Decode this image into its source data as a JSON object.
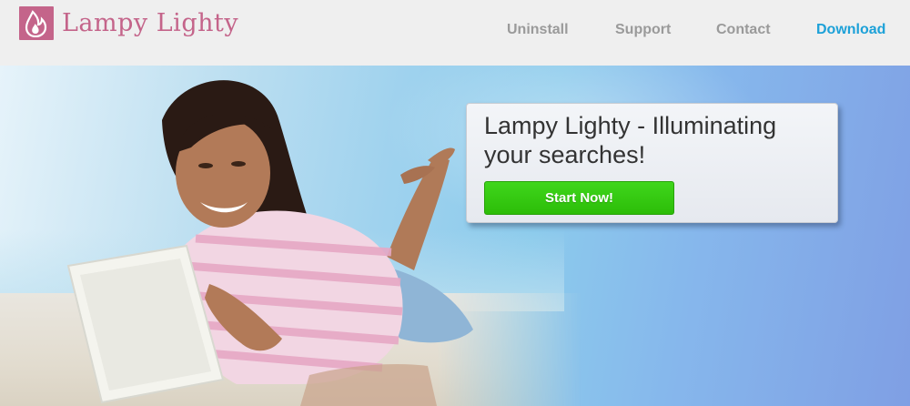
{
  "brand": {
    "name": "Lampy Lighty",
    "logo_icon": "flame-icon",
    "color": "#c4648a"
  },
  "nav": {
    "items": [
      {
        "label": "Uninstall"
      },
      {
        "label": "Support"
      },
      {
        "label": "Contact"
      },
      {
        "label": "Download",
        "active": true
      }
    ],
    "text_color": "#9a9a9a",
    "active_color": "#1da1d8"
  },
  "hero": {
    "image": "woman-on-beach-with-tablet",
    "headline": "Lampy Lighty - Illuminating your searches!",
    "cta_label": "Start Now!",
    "cta_color": "#2cbd08"
  }
}
